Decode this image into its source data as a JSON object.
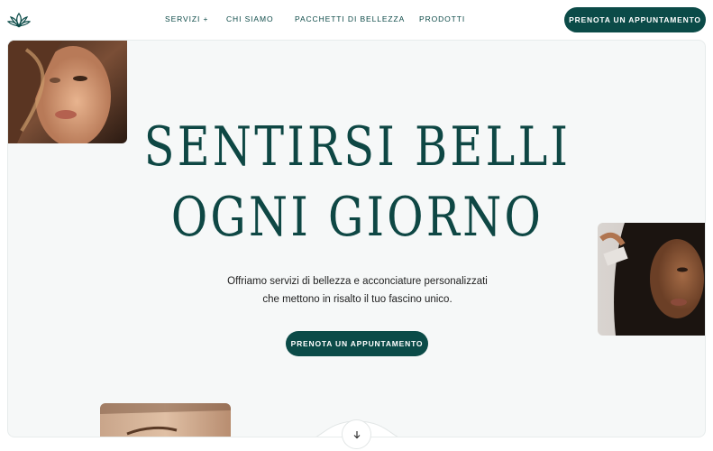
{
  "header": {
    "logo_icon": "lotus-icon",
    "nav": [
      {
        "label": "SERVIZI +"
      },
      {
        "label": "CHI SIAMO"
      },
      {
        "label": "PACCHETTI DI BELLEZZA"
      },
      {
        "label": "PRODOTTI"
      }
    ],
    "cta_label": "PRENOTA UN APPUNTAMENTO"
  },
  "hero": {
    "headline_line1": "SENTIRSI BELLI",
    "headline_line2": "OGNI GIORNO",
    "subtitle_line1": "Offriamo servizi di bellezza e acconciature personalizzati",
    "subtitle_line2": "che mettono in risalto il tuo fascino unico.",
    "cta_label": "PRENOTA UN APPUNTAMENTO",
    "scroll_icon": "arrow-down-icon"
  },
  "colors": {
    "brand": "#0b4b48",
    "hero_bg": "#f6f8f8",
    "text": "#222222"
  }
}
